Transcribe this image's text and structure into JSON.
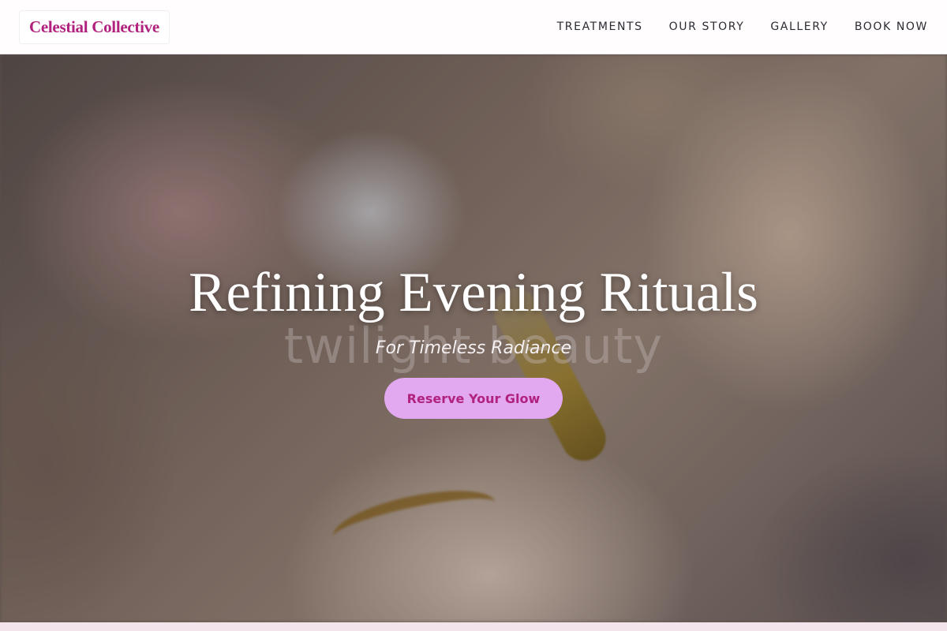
{
  "brand": {
    "name": "Celestial Collective",
    "color": "#b0227d"
  },
  "nav": {
    "items": [
      {
        "label": "TREATMENTS"
      },
      {
        "label": "OUR STORY"
      },
      {
        "label": "GALLERY"
      },
      {
        "label": "BOOK NOW"
      }
    ]
  },
  "hero": {
    "title": "Refining Evening Rituals",
    "watermark": "twilight beauty",
    "subtitle": "For Timeless Radiance",
    "cta_label": "Reserve Your Glow",
    "cta_background": "#e2a8f0",
    "cta_text_color": "#b0227d"
  }
}
